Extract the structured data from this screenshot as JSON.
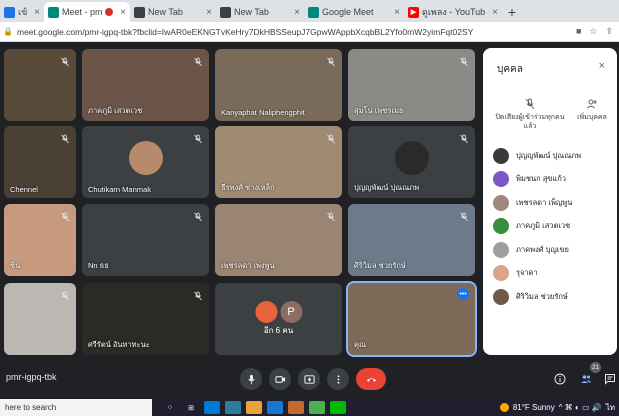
{
  "browser": {
    "tabs": [
      {
        "label": "เข้าสู่ระบบ",
        "fav_color": "#1a73e8",
        "fav_glyph": "",
        "active": false
      },
      {
        "label": "Meet - pmr-igpq",
        "fav_color": "#00897b",
        "fav_glyph": "",
        "active": true,
        "recording": true
      },
      {
        "label": "New Tab",
        "fav_color": "#3c4043",
        "fav_glyph": "",
        "active": false
      },
      {
        "label": "New Tab",
        "fav_color": "#3c4043",
        "fav_glyph": "",
        "active": false
      },
      {
        "label": "Google Meet",
        "fav_color": "#00897b",
        "fav_glyph": "",
        "active": false
      },
      {
        "label": "ดูเพลง - YouTube",
        "fav_color": "#ff0000",
        "fav_glyph": "▶",
        "active": false
      }
    ],
    "tab_close_glyph": "×",
    "new_tab_glyph": "+",
    "url": "meet.google.com/pmr-igpq-tbk?fbclid=IwAR0eEKNGTvKeHry7DkHBSSeupJ7GpwWAppbXcqbBL2Yfo0mW2yimFqt02SY"
  },
  "meeting": {
    "tiles": [
      {
        "name": "",
        "bg": "#5a4a3a"
      },
      {
        "name": "ภาคภูมิ เสวตเวช",
        "bg": "#6b5448"
      },
      {
        "name": "Kanyaphat Naliphengphit",
        "bg": "#7a6a5a"
      },
      {
        "name": "สุมโน เพชรเมธ",
        "bg": "#8a8a86"
      },
      {
        "name": "Chennel",
        "bg": "#4a4036"
      },
      {
        "name": "Chutikarn Manmak",
        "bg": "#3c4043",
        "avatar_bg": "#b68a6a"
      },
      {
        "name": "ธีรพงศ์ ช่างเหล็ก",
        "bg": "#a08a72"
      },
      {
        "name": "ปุญญพัฒน์ ปุณณภพ",
        "bg": "#3c4043",
        "avatar_bg": "#2a2a2a"
      },
      {
        "name": "ชิน",
        "bg": "#c79a80"
      },
      {
        "name": "Nn ธธ",
        "bg": "#3c4043"
      },
      {
        "name": "เพชรลดา เพ่งพูน",
        "bg": "#9a8472"
      },
      {
        "name": "ศิริวิมล ช่วยรักษ์",
        "bg": "#6c7a8a"
      },
      {
        "name": "",
        "bg": "#bcb7b2"
      },
      {
        "name": "ศรีรัตน์ อันทาทะนะ",
        "bg": "#2c2a26"
      },
      {
        "name": "อีก 6 คน",
        "bg": "#3c4043",
        "more_avatars": [
          {
            "letter": "",
            "color": "#e8643b"
          },
          {
            "letter": "P",
            "color": "#8d6e63"
          }
        ]
      },
      {
        "name": "คุณ",
        "bg": "#7d6a58"
      }
    ]
  },
  "people_panel": {
    "title": "บุคคล",
    "close_glyph": "×",
    "mute_all_label": "ปิดเสียงผู้เข้าร่วมทุกคนแล้ว",
    "add_label": "เพิ่มบุคคล",
    "people": [
      {
        "name": "ปุญญพัฒน์ ปุณณภพ",
        "color": "#3a3a3a"
      },
      {
        "name": "พิมชนก สุขแก้ว",
        "color": "#7e57c2"
      },
      {
        "name": "เพชรลดา เพ็ญพูน",
        "color": "#a1887f"
      },
      {
        "name": "ภาคภูมิ เสวตเวช",
        "color": "#388e3c"
      },
      {
        "name": "ภาคพงศ์ บุญเขย",
        "color": "#9e9e9e"
      },
      {
        "name": "รุจาดา",
        "color": "#d7a58a"
      },
      {
        "name": "ศิริวิมล ช่วยรักษ์",
        "color": "#6d5a48"
      }
    ]
  },
  "controls": {
    "meeting_code": "pmr-igpq-tbk",
    "participant_count": "21"
  },
  "taskbar": {
    "search_placeholder": "here to search",
    "weather": "81°F  Sunny",
    "clock": "ไท"
  }
}
